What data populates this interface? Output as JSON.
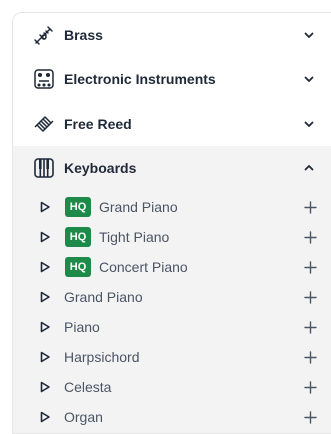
{
  "categories": [
    {
      "label": "Brass",
      "icon": "trumpet-icon",
      "expanded": false
    },
    {
      "label": "Electronic Instruments",
      "icon": "synth-module-icon",
      "expanded": false
    },
    {
      "label": "Free Reed",
      "icon": "accordion-icon",
      "expanded": false
    },
    {
      "label": "Keyboards",
      "icon": "piano-keys-icon",
      "expanded": true
    }
  ],
  "keyboards": {
    "items": [
      {
        "label": "Grand Piano",
        "badge": "HQ"
      },
      {
        "label": "Tight Piano",
        "badge": "HQ"
      },
      {
        "label": "Concert Piano",
        "badge": "HQ"
      },
      {
        "label": "Grand Piano"
      },
      {
        "label": "Piano"
      },
      {
        "label": "Harpsichord"
      },
      {
        "label": "Celesta"
      },
      {
        "label": "Organ"
      }
    ]
  },
  "colors": {
    "hq_badge": "#1e8a4a",
    "expanded_bg": "#f3f3f4",
    "text": "#1f2937"
  }
}
